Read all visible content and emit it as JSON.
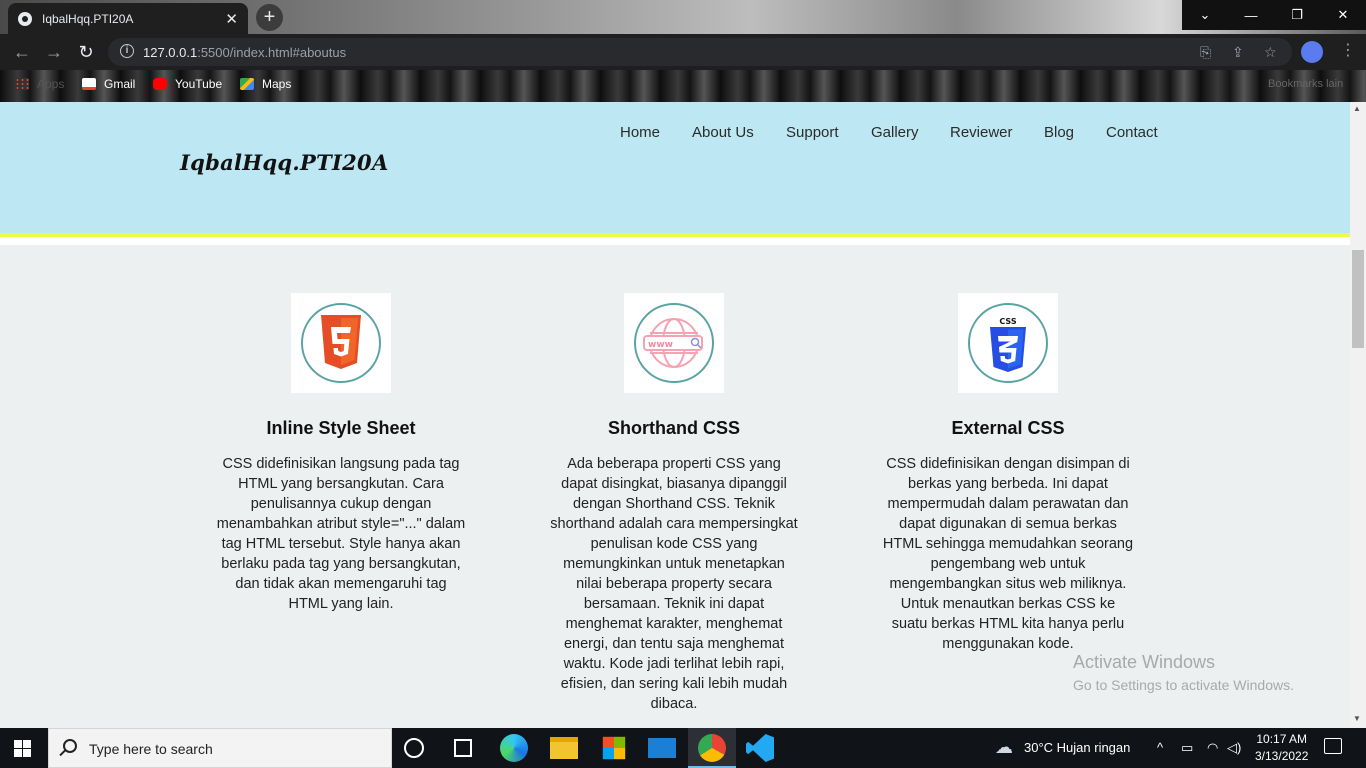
{
  "browser": {
    "tab_title": "IqbalHqq.PTI20A",
    "new_tab_symbol": "+",
    "url_host": "127.0.0.1",
    "url_path": ":5500/index.html#aboutus",
    "bookmarks": [
      "Apps",
      "Gmail",
      "YouTube",
      "Maps"
    ],
    "other_bookmarks": "Bookmarks lain"
  },
  "site": {
    "logo": "IqbalHqq.PTI20A",
    "nav": [
      "Home",
      "About Us",
      "Support",
      "Gallery",
      "Reviewer",
      "Blog",
      "Contact"
    ],
    "cards": [
      {
        "icon": "html5-icon",
        "title": "Inline Style Sheet",
        "lines": [
          "CSS didefinisikan langsung pada tag",
          "HTML yang bersangkutan. Cara",
          "penulisannya cukup dengan",
          "menambahkan atribut style=\"...\" dalam",
          "tag HTML tersebut. Style hanya akan",
          "berlaku pada tag yang bersangkutan,",
          "dan tidak akan memengaruhi tag",
          "HTML yang lain."
        ]
      },
      {
        "icon": "www-globe-icon",
        "title": "Shorthand CSS",
        "lines": [
          "Ada beberapa properti CSS yang",
          "dapat disingkat, biasanya dipanggil",
          "dengan Shorthand CSS. Teknik",
          "shorthand adalah cara mempersingkat",
          "penulisan kode CSS yang",
          "memungkinkan untuk menetapkan",
          "nilai beberapa property secara",
          "bersamaan. Teknik ini dapat",
          "menghemat karakter, menghemat",
          "energi, dan tentu saja menghemat",
          "waktu. Kode jadi terlihat lebih rapi,",
          "efisien, dan sering kali lebih mudah",
          "dibaca."
        ]
      },
      {
        "icon": "css3-icon",
        "title": "External CSS",
        "lines": [
          "CSS didefinisikan dengan disimpan di",
          "berkas yang berbeda. Ini dapat",
          "mempermudah dalam perawatan dan",
          "dapat digunakan di semua berkas",
          "HTML sehingga memudahkan seorang",
          "pengembang web untuk",
          "mengembangkan situs web miliknya.",
          "Untuk menautkan berkas CSS ke",
          "suatu berkas HTML kita hanya perlu",
          "menggunakan kode."
        ]
      }
    ]
  },
  "watermark": {
    "title": "Activate Windows",
    "subtitle": "Go to Settings to activate Windows."
  },
  "taskbar": {
    "search_placeholder": "Type here to search",
    "weather": "30°C  Hujan ringan",
    "time": "10:17 AM",
    "date": "3/13/2022"
  },
  "colors": {
    "header_bg": "#bde8f3",
    "header_line": "#e8fc50",
    "page_bg": "#ecf0f1",
    "html5_orange": "#e44d26",
    "css3_blue": "#264de4"
  }
}
